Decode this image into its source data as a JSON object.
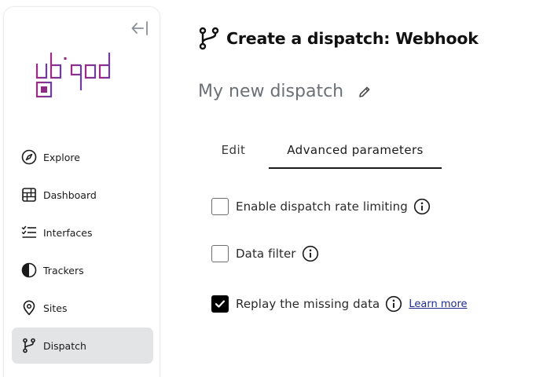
{
  "sidebar": {
    "collapse_icon": "collapse-left-icon",
    "logo_text": "ubiqod",
    "brand_color": "#8a2b84",
    "items": [
      {
        "label": "Explore",
        "icon": "compass-icon",
        "active": false
      },
      {
        "label": "Dashboard",
        "icon": "dashboard-grid-icon",
        "active": false
      },
      {
        "label": "Interfaces",
        "icon": "checklist-icon",
        "active": false
      },
      {
        "label": "Trackers",
        "icon": "half-circle-icon",
        "active": false
      },
      {
        "label": "Sites",
        "icon": "location-pin-icon",
        "active": false
      },
      {
        "label": "Dispatch",
        "icon": "branch-icon",
        "active": true
      }
    ]
  },
  "header": {
    "title": "Create a dispatch: Webhook",
    "title_icon": "branch-icon"
  },
  "dispatch": {
    "name": "My new dispatch",
    "edit_icon": "pencil-icon"
  },
  "tabs": [
    {
      "label": "Edit",
      "active": false
    },
    {
      "label": "Advanced parameters",
      "active": true
    }
  ],
  "options": [
    {
      "label": "Enable dispatch rate limiting",
      "checked": false
    },
    {
      "label": "Data filter",
      "checked": false
    },
    {
      "label": "Replay the missing data",
      "checked": true,
      "link": "Learn more"
    }
  ],
  "colors": {
    "active_nav_bg": "#e3e4e6",
    "link": "#1f2c8c",
    "checkbox_checked": "#000000"
  }
}
